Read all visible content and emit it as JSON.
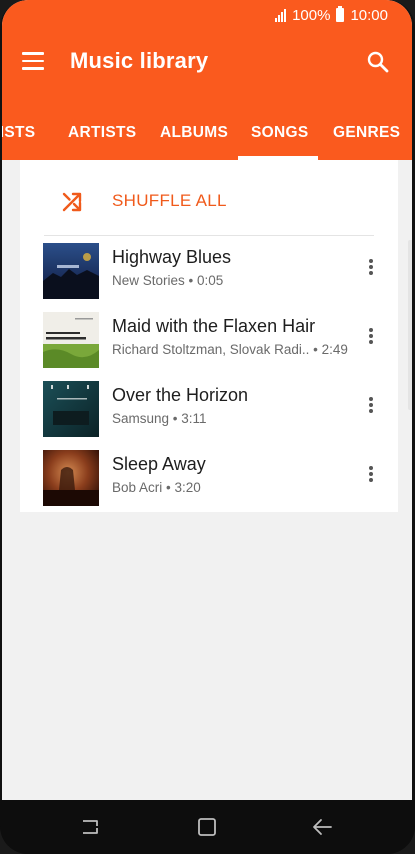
{
  "status_bar": {
    "battery_text": "100%",
    "time": "10:00"
  },
  "app_bar": {
    "title": "Music library"
  },
  "tabs": [
    {
      "label": "LISTS",
      "active": false
    },
    {
      "label": "ARTISTS",
      "active": false
    },
    {
      "label": "ALBUMS",
      "active": false
    },
    {
      "label": "SONGS",
      "active": true
    },
    {
      "label": "GENRES",
      "active": false
    }
  ],
  "shuffle": {
    "label": "SHUFFLE ALL"
  },
  "songs": [
    {
      "title": "Highway Blues",
      "artist": "New Stories",
      "duration": "0:05"
    },
    {
      "title": "Maid with the Flaxen Hair",
      "artist": "Richard Stoltzman, Slovak Radi..",
      "duration": "2:49"
    },
    {
      "title": "Over the Horizon",
      "artist": "Samsung",
      "duration": "3:11"
    },
    {
      "title": "Sleep Away",
      "artist": "Bob Acri",
      "duration": "3:20"
    }
  ],
  "album_art_text": {
    "maid": "RICHARD STOLTZMAN",
    "horizon": "OVER THE HORIZON"
  },
  "colors": {
    "accent": "#fa5a1e",
    "accent_text": "#f05a1b",
    "background": "#f1f1f1"
  },
  "icons": [
    "menu-icon",
    "search-icon",
    "shuffle-icon",
    "more-options-icon",
    "recents-icon",
    "home-icon",
    "back-icon"
  ]
}
